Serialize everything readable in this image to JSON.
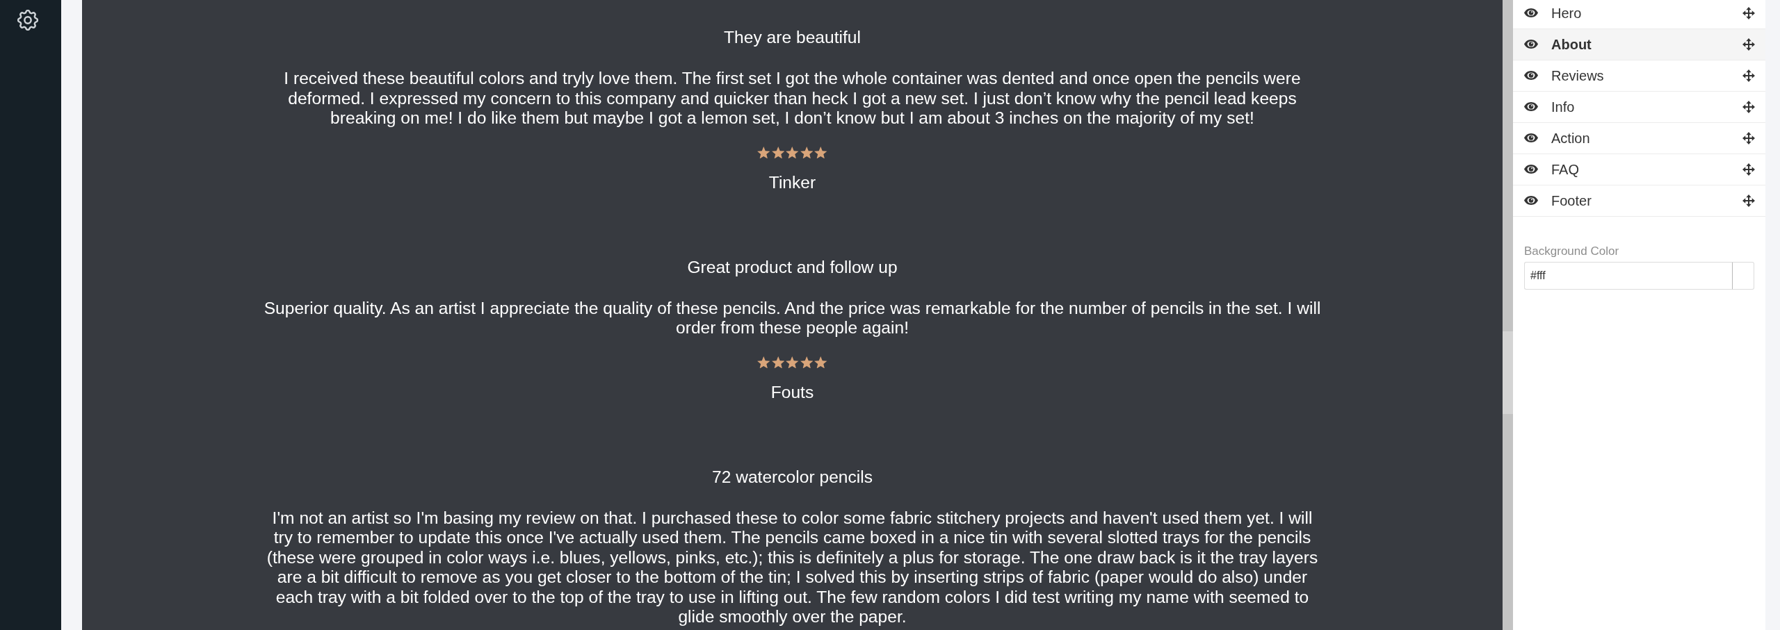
{
  "reviews": [
    {
      "title": "They are beautiful",
      "body": "I received these beautiful colors and tryly love them. The first set I got the whole container was dented and once open the pencils were deformed. I expressed my concern to this company and quicker than heck I got a new set. I just don’t know why the pencil lead keeps breaking on me! I do like them but maybe I got a lemon set, I don’t know but I am about 3 inches on the majority of my set!",
      "stars": 5,
      "author": "Tinker"
    },
    {
      "title": "Great product and follow up",
      "body": "Superior quality. As an artist I appreciate the quality of these pencils. And the price was remarkable for the number of pencils in the set. I will order from these people again!",
      "stars": 5,
      "author": "Fouts"
    },
    {
      "title": "72 watercolor pencils",
      "body": "I'm not an artist so I'm basing my review on that. I purchased these to color some fabric stitchery projects and haven't used them yet. I will try to remember to update this once I've actually used them. The pencils came boxed in a nice tin with several slotted trays for the pencils (these were grouped in color ways i.e. blues, yellows, pinks, etc.); this is definitely a plus for storage. The one draw back is it the tray layers are a bit difficult to remove as you get closer to the bottom of the tin; I solved this by inserting strips of fabric (paper would do also) under each tray with a bit folded over to the top of the tray to use in lifting out. The few random colors I did test writing my name with seemed to glide smoothly over the paper."
    }
  ],
  "sections": [
    {
      "label": "Hero",
      "visible": true,
      "selected": false
    },
    {
      "label": "About",
      "visible": true,
      "selected": true
    },
    {
      "label": "Reviews",
      "visible": true,
      "selected": false
    },
    {
      "label": "Info",
      "visible": true,
      "selected": false
    },
    {
      "label": "Action",
      "visible": true,
      "selected": false
    },
    {
      "label": "FAQ",
      "visible": true,
      "selected": false
    },
    {
      "label": "Footer",
      "visible": true,
      "selected": false
    }
  ],
  "background_color": {
    "label": "Background Color",
    "value": "#fff"
  }
}
